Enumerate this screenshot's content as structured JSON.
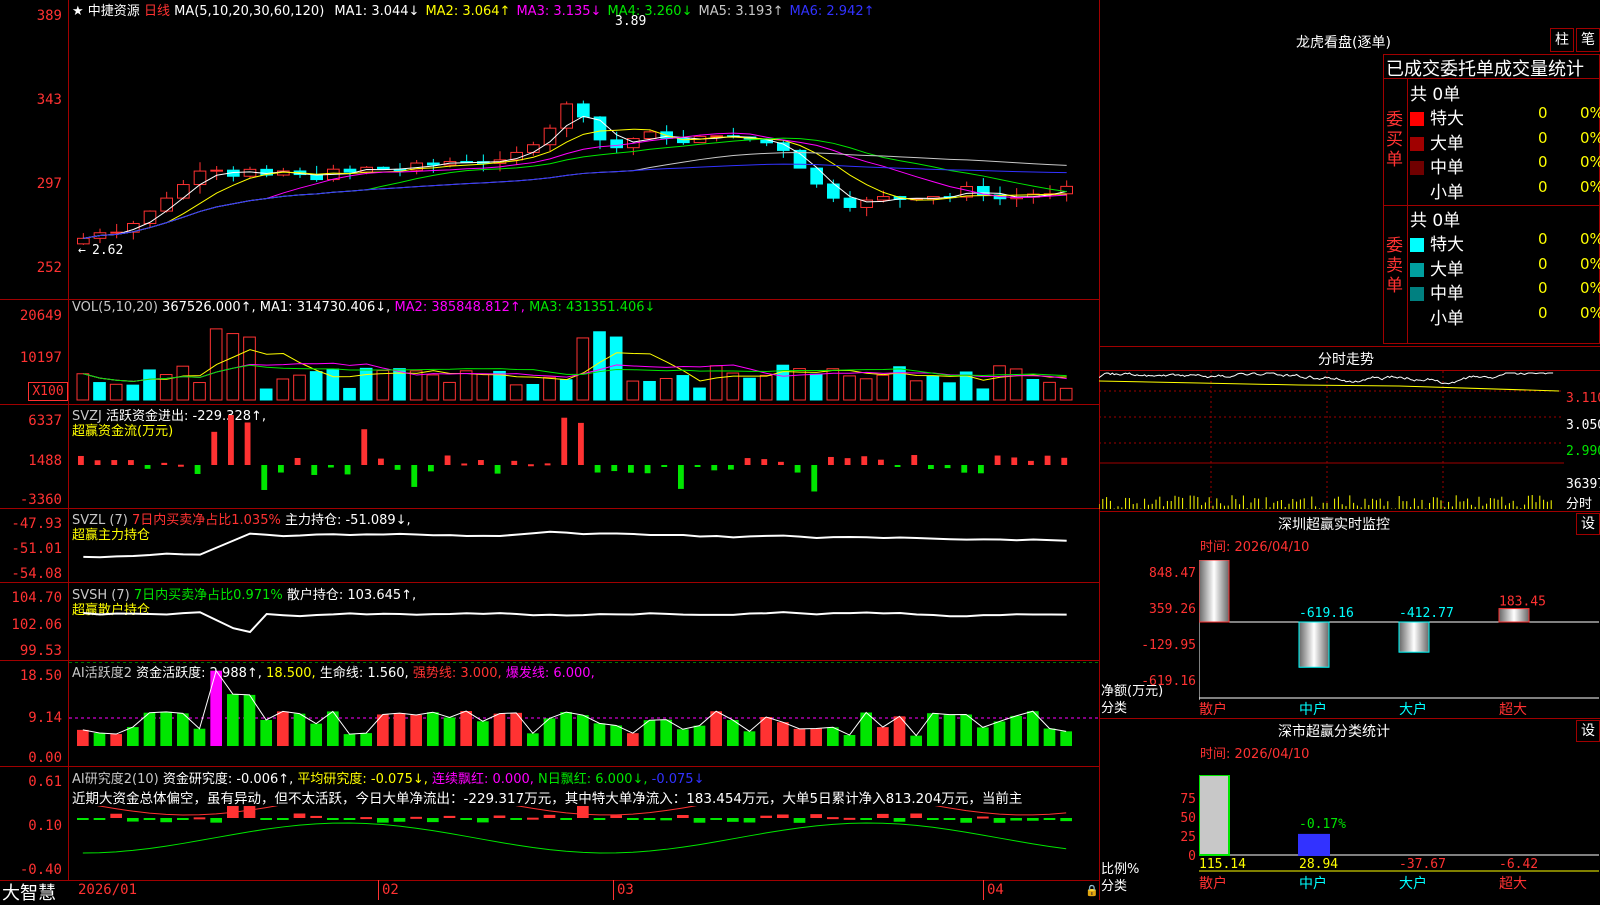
{
  "title": {
    "star": "★",
    "stock_name": "中捷资源",
    "period": "日线",
    "ma_params": "MA(5,10,20,30,60,120)",
    "ma_values": [
      {
        "label": "MA1:",
        "value": "3.044↓",
        "color": "#ffffff"
      },
      {
        "label": "MA2:",
        "value": "3.064↑",
        "color": "#ffff00"
      },
      {
        "label": "MA3:",
        "value": "3.135↓",
        "color": "#ff00ff"
      },
      {
        "label": "MA4:",
        "value": "3.260↓",
        "color": "#00e600"
      },
      {
        "label": "MA5:",
        "value": "3.193↑",
        "color": "#c8c8c8"
      },
      {
        "label": "MA6:",
        "value": "2.942↑",
        "color": "#3232ff"
      }
    ],
    "high_marker": "3.89",
    "low_marker": "2.62"
  },
  "price_axis": [
    "389",
    "343",
    "297",
    "252"
  ],
  "vol": {
    "header": "VOL(5,10,20)",
    "value": "367526.000↑,",
    "ma1": "MA1: 314730.406↓,",
    "ma2": "MA2: 385848.812↑,",
    "ma3": "MA3: 431351.406↓",
    "axis": [
      "20649",
      "10197",
      "X100"
    ]
  },
  "svzj": {
    "header": "SVZJ",
    "label": "活跃资金进出: -229.328↑,",
    "sub": "超赢资金流(万元)",
    "axis": [
      "6337",
      "1488",
      "-3360"
    ]
  },
  "svzl": {
    "header": "SVZL (7)",
    "pct": "7日内买卖净占比1.035%",
    "label": "主力持仓: -51.089↓,",
    "sub": "超赢主力持仓",
    "axis": [
      "-47.93",
      "-51.01",
      "-54.08"
    ]
  },
  "svsh": {
    "header": "SVSH (7)",
    "pct": "7日内买卖净占比0.971%",
    "label": "散户持仓: 103.645↑,",
    "sub": "超赢散户持仓",
    "axis": [
      "104.70",
      "102.06",
      "99.53"
    ]
  },
  "ai_active": {
    "header": "AI活跃度2",
    "label1": "资金活跃度: 2.988↑,",
    "v1": "18.500,",
    "label2": "生命线: 1.560,",
    "label3": "强势线: 3.000,",
    "label4": "爆发线: 6.000,",
    "axis": [
      "18.50",
      "9.14",
      "0.00"
    ]
  },
  "ai_research": {
    "header": "AI研究度2(10)",
    "label1": "资金研究度: -0.006↑,",
    "label2": "平均研究度: -0.075↓,",
    "label3": "连续飘红: 0.000,",
    "label4": "N日飘红: 6.000↓,",
    "label5": "-0.075↓",
    "note": "近期大资金总体偏空，虽有异动，但不太活跃，今日大单净流出：-229.317万元，其中特大单净流入：183.454万元，大单5日累计净入813.204万元，当前主",
    "axis": [
      "0.61",
      "0.10",
      "-0.40"
    ]
  },
  "date_axis": [
    "2026/01",
    "02",
    "03",
    "04"
  ],
  "brand": "大智慧",
  "dragon": {
    "title": "龙虎看盘(逐单)",
    "btn1": "柱",
    "btn2": "笔",
    "subtitle": "已成交委托单成交量统计",
    "buy_side": "委买单",
    "sell_side": "委卖单",
    "buy_total": "共 0单",
    "sell_total": "共 0单",
    "buy_rows": [
      {
        "name": "特大",
        "count": "0",
        "pct": "0%",
        "color": "#ff0000"
      },
      {
        "name": "大单",
        "count": "0",
        "pct": "0%",
        "color": "#a00000"
      },
      {
        "name": "中单",
        "count": "0",
        "pct": "0%",
        "color": "#700000"
      },
      {
        "name": "小单",
        "count": "0",
        "pct": "0%",
        "color": ""
      }
    ],
    "sell_rows": [
      {
        "name": "特大",
        "count": "0",
        "pct": "0%",
        "color": "#00ffff"
      },
      {
        "name": "大单",
        "count": "0",
        "pct": "0%",
        "color": "#00a0a0"
      },
      {
        "name": "中单",
        "count": "0",
        "pct": "0%",
        "color": "#008080"
      },
      {
        "name": "小单",
        "count": "0",
        "pct": "0%",
        "color": ""
      }
    ]
  },
  "intraday": {
    "title": "分时走势",
    "axis": [
      "3.110",
      "3.050",
      "2.990",
      "36397",
      "分时"
    ]
  },
  "monitor": {
    "title": "深圳超赢实时监控",
    "btn": "设",
    "time": "时间: 2026/04/10",
    "axis": [
      "848.47",
      "359.26",
      "-129.95",
      "-619.16"
    ],
    "ylabel": "净额(万元)",
    "xlabel": "分类",
    "bars": [
      {
        "name": "散户",
        "value": "848.47"
      },
      {
        "name": "中户",
        "value": "-619.16"
      },
      {
        "name": "大户",
        "value": "-412.77"
      },
      {
        "name": "超大",
        "value": "183.45"
      }
    ]
  },
  "classify": {
    "title": "深市超赢分类统计",
    "btn": "设",
    "time": "时间: 2026/04/10",
    "axis": [
      "75",
      "50",
      "25",
      "0"
    ],
    "ylabel": "比例%",
    "xlabel": "分类",
    "mid_label": "-0.17%",
    "bars": [
      {
        "name": "散户",
        "value": "115.14"
      },
      {
        "name": "中户",
        "value": "28.94"
      },
      {
        "name": "大户",
        "value": "-37.67"
      },
      {
        "name": "超大",
        "value": "-6.42"
      }
    ]
  }
}
